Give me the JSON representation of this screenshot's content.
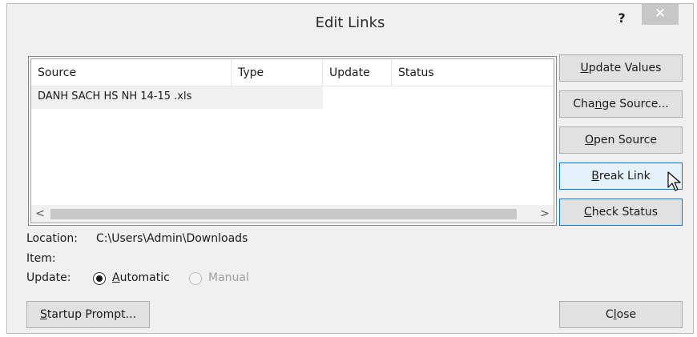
{
  "window": {
    "title": "Edit Links",
    "help_label": "?",
    "close_label": "✕"
  },
  "links_table": {
    "columns": [
      "Source",
      "Type",
      "Update",
      "Status"
    ],
    "rows": [
      {
        "source": "DANH SACH HS NH 14-15 .xls",
        "type": "",
        "update": "",
        "status": ""
      }
    ],
    "scroll_left": "<",
    "scroll_right": ">"
  },
  "buttons": {
    "update_values": {
      "prefix": "",
      "access": "U",
      "rest": "pdate Values"
    },
    "change_source": {
      "prefix": "Cha",
      "access": "n",
      "rest": "ge Source..."
    },
    "open_source": {
      "prefix": "",
      "access": "O",
      "rest": "pen Source"
    },
    "break_link": {
      "prefix": "",
      "access": "B",
      "rest": "reak Link"
    },
    "check_status": {
      "prefix": "",
      "access": "C",
      "rest": "heck Status"
    },
    "startup_prompt": {
      "prefix": "",
      "access": "S",
      "rest": "tartup Prompt..."
    },
    "close": {
      "prefix": "C",
      "access": "l",
      "rest": "ose"
    }
  },
  "details": {
    "location_label": "Location:",
    "location_value": "C:\\Users\\Admin\\Downloads",
    "item_label": "Item:",
    "item_value": "",
    "update_label": "Update:",
    "automatic": {
      "prefix": "",
      "access": "A",
      "rest": "utomatic",
      "checked": true
    },
    "manual": {
      "label": "Manual",
      "checked": false,
      "disabled": true
    }
  }
}
